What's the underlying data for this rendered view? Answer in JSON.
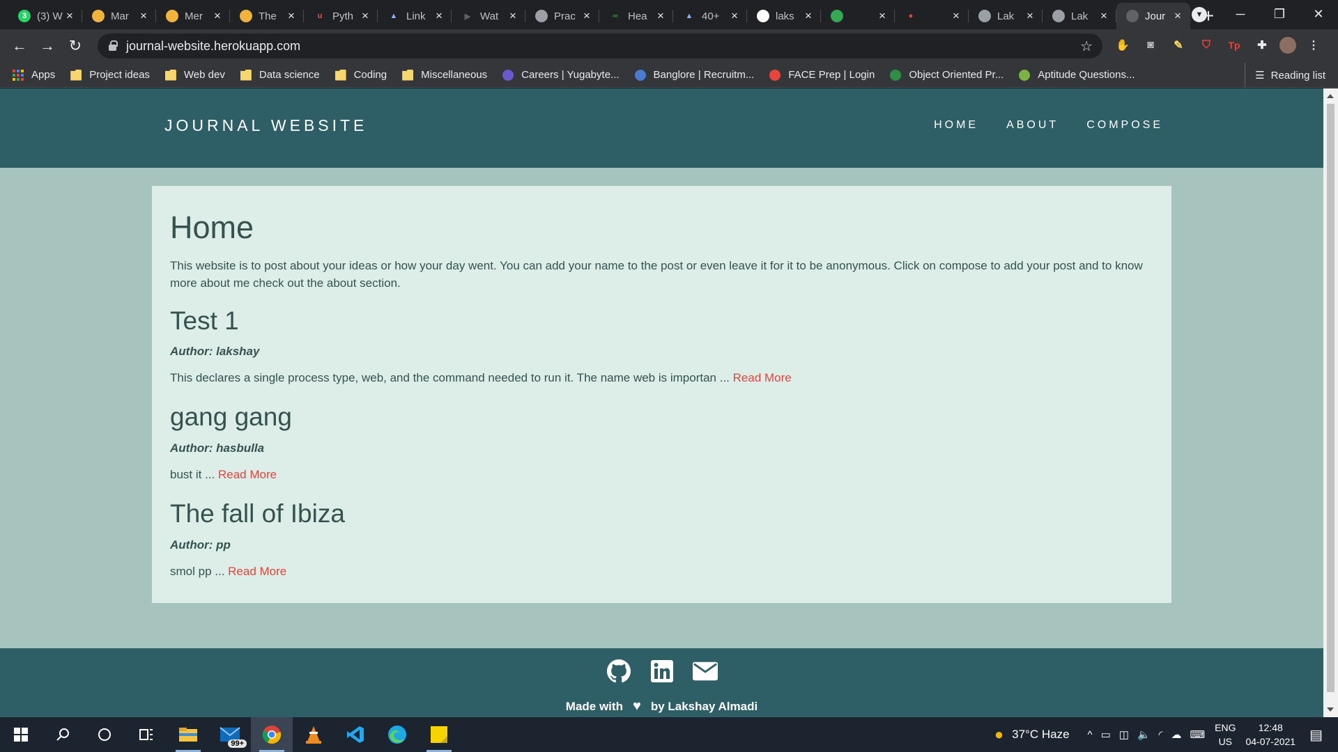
{
  "browser": {
    "tabs": [
      {
        "title": "(3) W",
        "favicon": "whatsapp-icon",
        "color": "#25d366",
        "glyph": "3"
      },
      {
        "title": "Mar",
        "favicon": "medium-icon",
        "color": "#f0b43c",
        "glyph": ""
      },
      {
        "title": "Mer",
        "favicon": "medium-icon",
        "color": "#f0b43c",
        "glyph": ""
      },
      {
        "title": "The",
        "favicon": "medium-icon",
        "color": "#f0b43c",
        "glyph": ""
      },
      {
        "title": "Pyth",
        "favicon": "udemy-icon",
        "color": "#ec5252",
        "glyph": "u"
      },
      {
        "title": "Link",
        "favicon": "mountain-icon",
        "color": "#8ab4f8",
        "glyph": "▲"
      },
      {
        "title": "Wat",
        "favicon": "play-icon",
        "color": "#5f6368",
        "glyph": "▶"
      },
      {
        "title": "Prac",
        "favicon": "globe-icon",
        "color": "#9aa0a6",
        "glyph": ""
      },
      {
        "title": "Hea",
        "favicon": "gfg-icon",
        "color": "#2f8d46",
        "glyph": "∞"
      },
      {
        "title": "40+",
        "favicon": "mountain-icon",
        "color": "#8ab4f8",
        "glyph": "▲"
      },
      {
        "title": "laks",
        "favicon": "github-icon",
        "color": "#ffffff",
        "glyph": ""
      },
      {
        "title": "",
        "favicon": "meet-icon",
        "color": "#34a853",
        "glyph": ""
      },
      {
        "title": "",
        "favicon": "record-icon",
        "color": "#ea4335",
        "glyph": "●"
      },
      {
        "title": "Lak",
        "favicon": "globe-icon",
        "color": "#9aa0a6",
        "glyph": ""
      },
      {
        "title": "Lak",
        "favicon": "globe-icon",
        "color": "#9aa0a6",
        "glyph": ""
      },
      {
        "title": "Jour",
        "favicon": "globe-icon",
        "color": "#5f6368",
        "glyph": "",
        "active": true
      }
    ],
    "new_tab": "+",
    "url": "journal-website.herokuapp.com",
    "bookmarks": [
      {
        "label": "Apps",
        "icon": "apps-grid-icon"
      },
      {
        "label": "Project ideas",
        "icon": "folder-icon"
      },
      {
        "label": "Web dev",
        "icon": "folder-icon"
      },
      {
        "label": "Data science",
        "icon": "folder-icon"
      },
      {
        "label": "Coding",
        "icon": "folder-icon"
      },
      {
        "label": "Miscellaneous",
        "icon": "folder-icon"
      },
      {
        "label": "Careers | Yugabyte...",
        "icon": "yugabyte-icon"
      },
      {
        "label": "Banglore | Recruitm...",
        "icon": "globe-icon"
      },
      {
        "label": "FACE Prep | Login",
        "icon": "faceprep-icon"
      },
      {
        "label": "Object Oriented Pr...",
        "icon": "gfg-icon"
      },
      {
        "label": "Aptitude Questions...",
        "icon": "leaf-icon"
      }
    ],
    "reading_list": "Reading list"
  },
  "site": {
    "brand": "JOURNAL WEBSITE",
    "nav": [
      "HOME",
      "ABOUT",
      "COMPOSE"
    ],
    "page_title": "Home",
    "intro": "This website is to post about your ideas or how your day went. You can add your name to the post or even leave it for it to be anonymous. Click on compose to add your post and to know more about me check out the about section.",
    "posts": [
      {
        "title": "Test 1",
        "author": "Author: lakshay",
        "excerpt": "This declares a single process type, web, and the command needed to run it. The name web is importan ...",
        "read_more": "Read More"
      },
      {
        "title": "gang gang",
        "author": "Author: hasbulla",
        "excerpt": "bust it ...",
        "read_more": "Read More"
      },
      {
        "title": "The fall of Ibiza",
        "author": "Author: pp",
        "excerpt": "smol pp ...",
        "read_more": "Read More"
      }
    ],
    "footer": {
      "made_with": "Made with",
      "by": "by Lakshay Almadi",
      "social": [
        "github-icon",
        "linkedin-icon",
        "mail-icon"
      ]
    },
    "colors": {
      "header": "#2e5e66",
      "background": "#a6c4bd",
      "card": "#ddeee9",
      "link": "#e0443b",
      "text": "#35524f"
    }
  },
  "taskbar": {
    "notification_badge": "99+",
    "weather": "37°C  Haze",
    "language": "ENG",
    "region": "US",
    "time": "12:48",
    "date": "04-07-2021"
  }
}
